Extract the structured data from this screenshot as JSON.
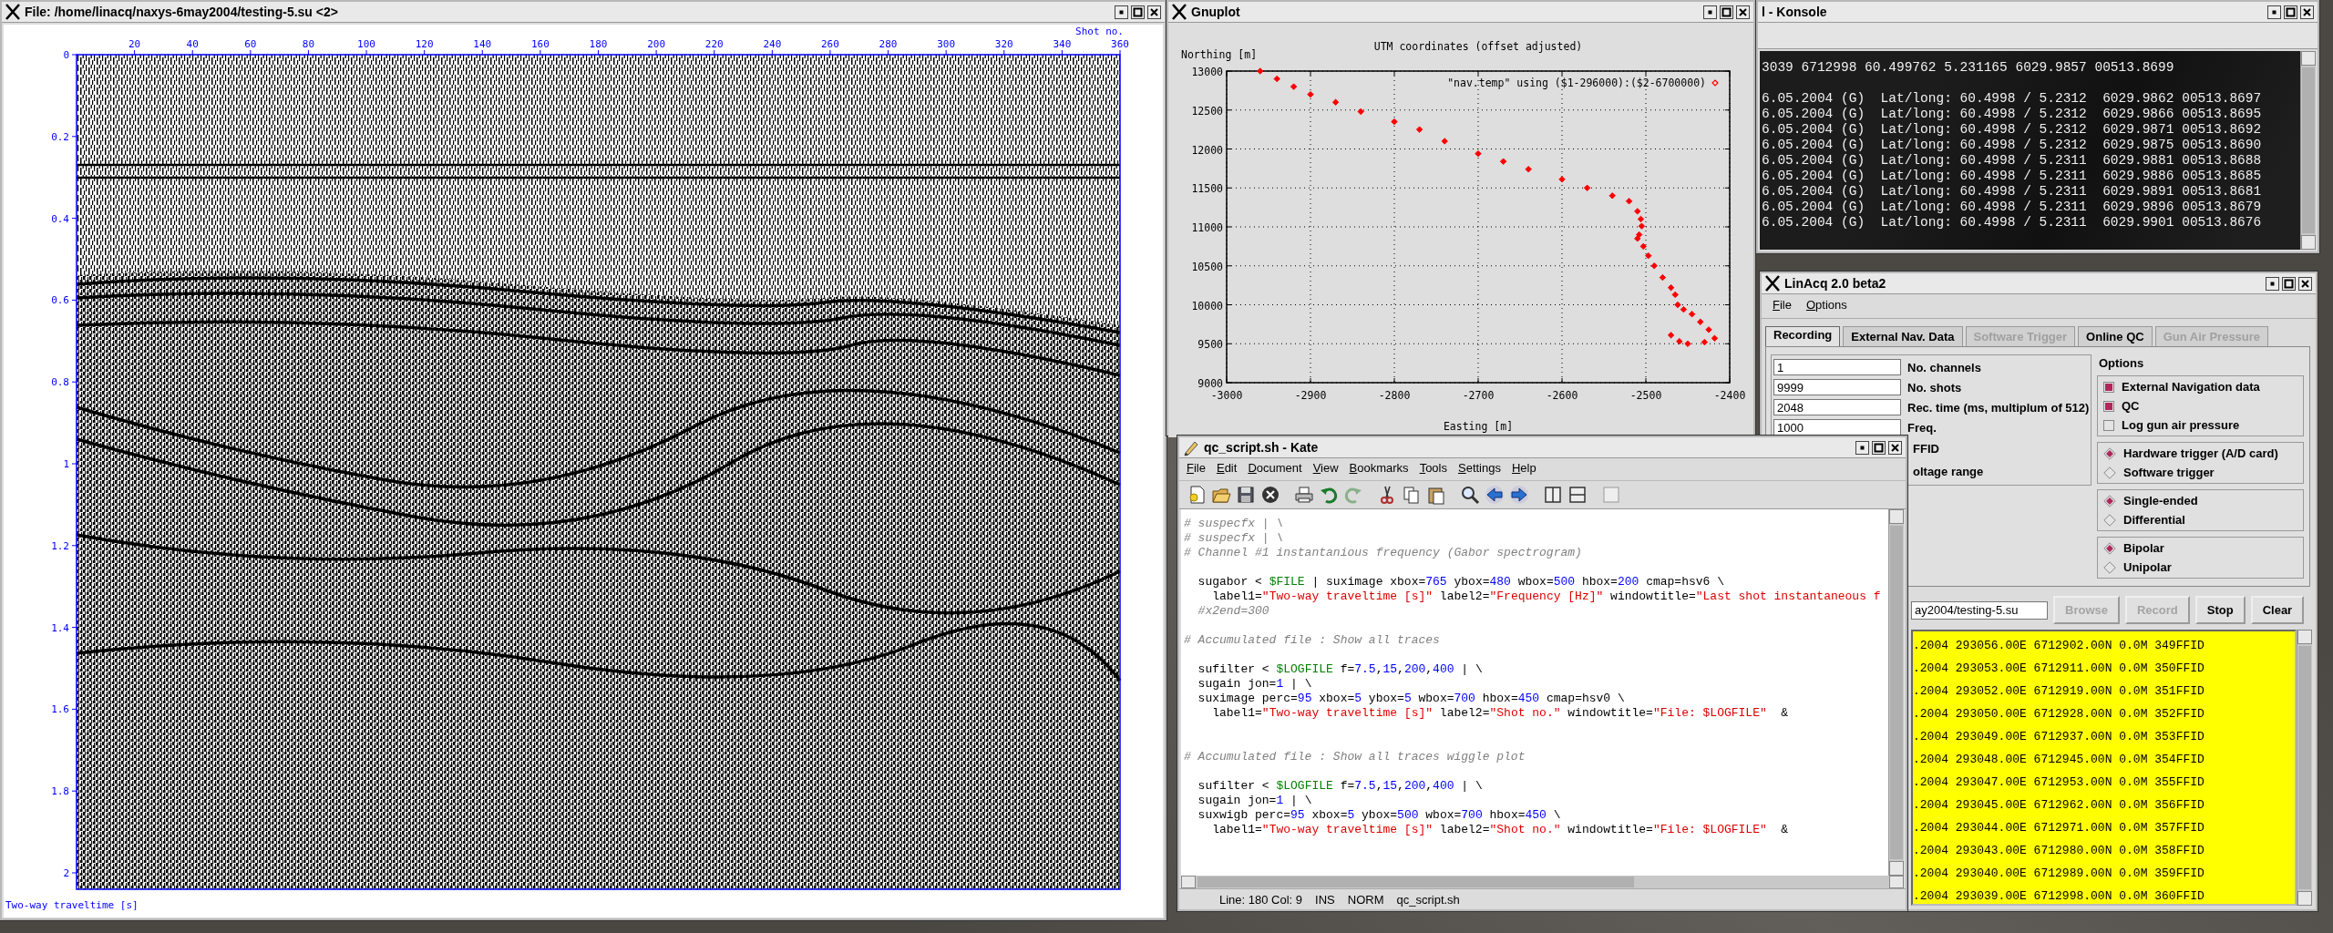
{
  "seismic_window": {
    "title": "File: /home/linacq/naxys-6may2004/testing-5.su <2>",
    "x_axis_label": "Shot no.",
    "x_ticks": [
      "20",
      "40",
      "60",
      "80",
      "100",
      "120",
      "140",
      "160",
      "180",
      "200",
      "220",
      "240",
      "260",
      "280",
      "300",
      "320",
      "340",
      "360"
    ],
    "y_ticks": [
      "0",
      "0.2",
      "0.4",
      "0.6",
      "0.8",
      "1",
      "1.2",
      "1.4",
      "1.6",
      "1.8",
      "2"
    ],
    "y_axis_label": "Two-way traveltime [s]"
  },
  "gnuplot_window": {
    "title": "Gnuplot",
    "chart_data": {
      "type": "scatter",
      "title": "UTM coordinates (offset adjusted)",
      "xlabel": "Easting [m]",
      "ylabel": "Northing [m]",
      "x": [
        -2960,
        -2940,
        -2920,
        -2900,
        -2870,
        -2840,
        -2800,
        -2770,
        -2740,
        -2700,
        -2670,
        -2640,
        -2600,
        -2570,
        -2540,
        -2520,
        -2510,
        -2506,
        -2505,
        -2508,
        -2510,
        -2503,
        -2497,
        -2490,
        -2480,
        -2470,
        -2465,
        -2462,
        -2455,
        -2445,
        -2435,
        -2425,
        -2418,
        -2430,
        -2450,
        -2460,
        -2470
      ],
      "series": [
        {
          "name": "\"nav.temp\" using ($1-296000):($2-6700000)",
          "color": "#ff0000",
          "values": [
            13000,
            12900,
            12800,
            12700,
            12600,
            12480,
            12350,
            12250,
            12100,
            11940,
            11840,
            11740,
            11610,
            11500,
            11400,
            11330,
            11200,
            11100,
            11010,
            10900,
            10850,
            10750,
            10630,
            10500,
            10350,
            10220,
            10130,
            10000,
            9940,
            9880,
            9780,
            9680,
            9570,
            9520,
            9500,
            9530,
            9610
          ]
        }
      ],
      "grid": true,
      "xlim": [
        -3000,
        -2400
      ],
      "ylim": [
        9000,
        13000
      ],
      "xticks": [
        -3000,
        -2900,
        -2800,
        -2700,
        -2600,
        -2500,
        -2400
      ],
      "yticks": [
        9000,
        9500,
        10000,
        10500,
        11000,
        11500,
        12000,
        12500,
        13000
      ]
    }
  },
  "konsole_window": {
    "title": "l - Konsole",
    "header_line": "3039 6712998 60.499762 5.231165 6029.9857 00513.8699",
    "lines": [
      "6.05.2004 (G)  Lat/long: 60.4998 / 5.2312  6029.9862 00513.8697",
      "6.05.2004 (G)  Lat/long: 60.4998 / 5.2312  6029.9866 00513.8695",
      "6.05.2004 (G)  Lat/long: 60.4998 / 5.2312  6029.9871 00513.8692",
      "6.05.2004 (G)  Lat/long: 60.4998 / 5.2312  6029.9875 00513.8690",
      "6.05.2004 (G)  Lat/long: 60.4998 / 5.2311  6029.9881 00513.8688",
      "6.05.2004 (G)  Lat/long: 60.4998 / 5.2311  6029.9886 00513.8685",
      "6.05.2004 (G)  Lat/long: 60.4998 / 5.2311  6029.9891 00513.8681",
      "6.05.2004 (G)  Lat/long: 60.4998 / 5.2311  6029.9896 00513.8679",
      "6.05.2004 (G)  Lat/long: 60.4998 / 5.2311  6029.9901 00513.8676"
    ]
  },
  "linacq_window": {
    "title": "LinAcq 2.0 beta2",
    "menu": [
      "File",
      "Options"
    ],
    "tabs": [
      {
        "label": "Recording",
        "selected": true,
        "disabled": false
      },
      {
        "label": "External Nav. Data",
        "selected": false,
        "disabled": false
      },
      {
        "label": "Software Trigger",
        "selected": false,
        "disabled": true
      },
      {
        "label": "Online QC",
        "selected": false,
        "disabled": false
      },
      {
        "label": "Gun Air Pressure",
        "selected": false,
        "disabled": true
      }
    ],
    "fields": [
      {
        "value": "1",
        "label": "No. channels"
      },
      {
        "value": "9999",
        "label": "No. shots"
      },
      {
        "value": "2048",
        "label": "Rec. time (ms, multiplum of 512)"
      },
      {
        "value": "1000",
        "label": "Freq."
      },
      {
        "label": "FFID"
      },
      {
        "label": "oltage range"
      }
    ],
    "options_heading": "Options",
    "checkboxes": [
      {
        "label": "External Navigation data",
        "checked": true
      },
      {
        "label": "QC",
        "checked": true
      },
      {
        "label": "Log gun air pressure",
        "checked": false
      }
    ],
    "radio_groups": [
      {
        "options": [
          {
            "label": "Hardware trigger (A/D card)",
            "selected": true
          },
          {
            "label": "Software trigger",
            "selected": false
          }
        ]
      },
      {
        "options": [
          {
            "label": "Single-ended",
            "selected": true
          },
          {
            "label": "Differential",
            "selected": false
          }
        ]
      },
      {
        "options": [
          {
            "label": "Bipolar",
            "selected": true
          },
          {
            "label": "Unipolar",
            "selected": false
          }
        ]
      }
    ],
    "path_field": {
      "value": "ay2004/testing-5.su"
    },
    "buttons": [
      {
        "label": "Browse",
        "disabled": true
      },
      {
        "label": "Record",
        "disabled": true
      },
      {
        "label": "Stop",
        "disabled": false
      },
      {
        "label": "Clear",
        "disabled": false
      }
    ],
    "log_lines": [
      ".2004 293056.00E 6712902.00N 0.0M 349FFID",
      ".2004 293053.00E 6712911.00N 0.0M 350FFID",
      ".2004 293052.00E 6712919.00N 0.0M 351FFID",
      ".2004 293050.00E 6712928.00N 0.0M 352FFID",
      ".2004 293049.00E 6712937.00N 0.0M 353FFID",
      ".2004 293048.00E 6712945.00N 0.0M 354FFID",
      ".2004 293047.00E 6712953.00N 0.0M 355FFID",
      ".2004 293045.00E 6712962.00N 0.0M 356FFID",
      ".2004 293044.00E 6712971.00N 0.0M 357FFID",
      ".2004 293043.00E 6712980.00N 0.0M 358FFID",
      ".2004 293040.00E 6712989.00N 0.0M 359FFID",
      ".2004 293039.00E 6712998.00N 0.0M 360FFID"
    ]
  },
  "kate_window": {
    "title": "qc_script.sh - Kate",
    "menu": [
      "File",
      "Edit",
      "Document",
      "View",
      "Bookmarks",
      "Tools",
      "Settings",
      "Help"
    ],
    "code_lines": [
      {
        "kind": "code",
        "segments": [
          {
            "kind": "comment",
            "text": "# suspecfx | \\"
          }
        ]
      },
      {
        "kind": "code",
        "segments": [
          {
            "kind": "comment",
            "text": "# suspecfx | \\"
          }
        ]
      },
      {
        "kind": "code",
        "segments": [
          {
            "kind": "comment",
            "text": "# Channel #1 instantanious frequency (Gabor spectrogram)"
          }
        ]
      },
      {
        "kind": "blank"
      },
      {
        "kind": "code",
        "segments": [
          {
            "kind": "text",
            "text": "  sugabor < "
          },
          {
            "kind": "variable",
            "text": "$FILE"
          },
          {
            "kind": "text",
            "text": " | suximage xbox="
          },
          {
            "kind": "number",
            "text": "765"
          },
          {
            "kind": "text",
            "text": " ybox="
          },
          {
            "kind": "number",
            "text": "480"
          },
          {
            "kind": "text",
            "text": " wbox="
          },
          {
            "kind": "number",
            "text": "500"
          },
          {
            "kind": "text",
            "text": " hbox="
          },
          {
            "kind": "number",
            "text": "200"
          },
          {
            "kind": "text",
            "text": " cmap=hsv6 \\"
          }
        ]
      },
      {
        "kind": "code",
        "segments": [
          {
            "kind": "text",
            "text": "    label1="
          },
          {
            "kind": "string",
            "text": "\"Two-way traveltime [s]\""
          },
          {
            "kind": "text",
            "text": " label2="
          },
          {
            "kind": "string",
            "text": "\"Frequency [Hz]\""
          },
          {
            "kind": "text",
            "text": " windowtitle="
          },
          {
            "kind": "string",
            "text": "\"Last shot instantaneous f"
          }
        ]
      },
      {
        "kind": "code",
        "segments": [
          {
            "kind": "comment",
            "text": "  #x2end=300"
          }
        ]
      },
      {
        "kind": "blank"
      },
      {
        "kind": "code",
        "segments": [
          {
            "kind": "comment",
            "text": "# Accumulated file : Show all traces"
          }
        ]
      },
      {
        "kind": "blank"
      },
      {
        "kind": "code",
        "segments": [
          {
            "kind": "text",
            "text": "  sufilter < "
          },
          {
            "kind": "variable",
            "text": "$LOGFILE"
          },
          {
            "kind": "text",
            "text": " f="
          },
          {
            "kind": "number",
            "text": "7.5"
          },
          {
            "kind": "text",
            "text": ","
          },
          {
            "kind": "number",
            "text": "15"
          },
          {
            "kind": "text",
            "text": ","
          },
          {
            "kind": "number",
            "text": "200"
          },
          {
            "kind": "text",
            "text": ","
          },
          {
            "kind": "number",
            "text": "400"
          },
          {
            "kind": "text",
            "text": " | \\"
          }
        ]
      },
      {
        "kind": "code",
        "segments": [
          {
            "kind": "text",
            "text": "  sugain jon="
          },
          {
            "kind": "number",
            "text": "1"
          },
          {
            "kind": "text",
            "text": " | \\"
          }
        ]
      },
      {
        "kind": "code",
        "segments": [
          {
            "kind": "text",
            "text": "  suximage perc="
          },
          {
            "kind": "number",
            "text": "95"
          },
          {
            "kind": "text",
            "text": " xbox="
          },
          {
            "kind": "number",
            "text": "5"
          },
          {
            "kind": "text",
            "text": " ybox="
          },
          {
            "kind": "number",
            "text": "5"
          },
          {
            "kind": "text",
            "text": " wbox="
          },
          {
            "kind": "number",
            "text": "700"
          },
          {
            "kind": "text",
            "text": " hbox="
          },
          {
            "kind": "number",
            "text": "450"
          },
          {
            "kind": "text",
            "text": " cmap=hsv0 \\"
          }
        ]
      },
      {
        "kind": "code",
        "segments": [
          {
            "kind": "text",
            "text": "    label1="
          },
          {
            "kind": "string",
            "text": "\"Two-way traveltime [s]\""
          },
          {
            "kind": "text",
            "text": " label2="
          },
          {
            "kind": "string",
            "text": "\"Shot no.\""
          },
          {
            "kind": "text",
            "text": " windowtitle="
          },
          {
            "kind": "string",
            "text": "\"File: $LOGFILE\""
          },
          {
            "kind": "text",
            "text": "  &"
          }
        ]
      },
      {
        "kind": "blank"
      },
      {
        "kind": "blank"
      },
      {
        "kind": "code",
        "segments": [
          {
            "kind": "comment",
            "text": "# Accumulated file : Show all traces wiggle plot"
          }
        ]
      },
      {
        "kind": "blank"
      },
      {
        "kind": "code",
        "segments": [
          {
            "kind": "text",
            "text": "  sufilter < "
          },
          {
            "kind": "variable",
            "text": "$LOGFILE"
          },
          {
            "kind": "text",
            "text": " f="
          },
          {
            "kind": "number",
            "text": "7.5"
          },
          {
            "kind": "text",
            "text": ","
          },
          {
            "kind": "number",
            "text": "15"
          },
          {
            "kind": "text",
            "text": ","
          },
          {
            "kind": "number",
            "text": "200"
          },
          {
            "kind": "text",
            "text": ","
          },
          {
            "kind": "number",
            "text": "400"
          },
          {
            "kind": "text",
            "text": " | \\"
          }
        ]
      },
      {
        "kind": "code",
        "segments": [
          {
            "kind": "text",
            "text": "  sugain jon="
          },
          {
            "kind": "number",
            "text": "1"
          },
          {
            "kind": "text",
            "text": " | \\"
          }
        ]
      },
      {
        "kind": "code",
        "segments": [
          {
            "kind": "text",
            "text": "  suxwigb perc="
          },
          {
            "kind": "number",
            "text": "95"
          },
          {
            "kind": "text",
            "text": " xbox="
          },
          {
            "kind": "number",
            "text": "5"
          },
          {
            "kind": "text",
            "text": " ybox="
          },
          {
            "kind": "number",
            "text": "500"
          },
          {
            "kind": "text",
            "text": " wbox="
          },
          {
            "kind": "number",
            "text": "700"
          },
          {
            "kind": "text",
            "text": " hbox="
          },
          {
            "kind": "number",
            "text": "450"
          },
          {
            "kind": "text",
            "text": " \\"
          }
        ]
      },
      {
        "kind": "code",
        "segments": [
          {
            "kind": "text",
            "text": "    label1="
          },
          {
            "kind": "string",
            "text": "\"Two-way traveltime [s]\""
          },
          {
            "kind": "text",
            "text": " label2="
          },
          {
            "kind": "string",
            "text": "\"Shot no.\""
          },
          {
            "kind": "text",
            "text": " windowtitle="
          },
          {
            "kind": "string",
            "text": "\"File: $LOGFILE\""
          },
          {
            "kind": "text",
            "text": "  &"
          }
        ]
      }
    ],
    "status_items": [
      "Line: 180 Col: 9",
      "INS",
      "NORM",
      "qc_script.sh"
    ]
  }
}
